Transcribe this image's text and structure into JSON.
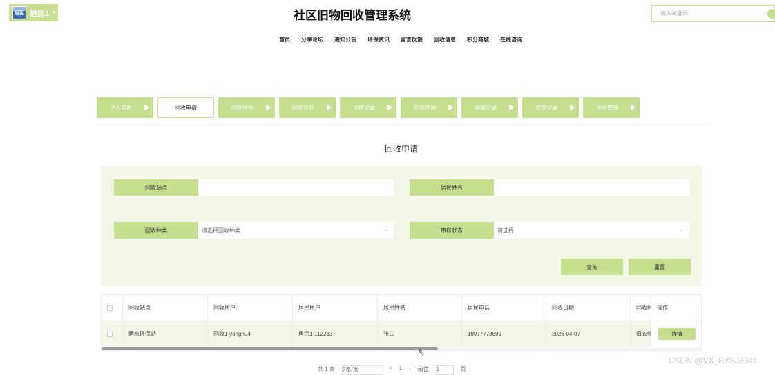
{
  "header": {
    "user_name": "居民1",
    "avatar_text": "居民",
    "site_title": "社区旧物回收管理系统",
    "search_placeholder": "输入关键词"
  },
  "nav": [
    "首页",
    "分享论坛",
    "通知公告",
    "环保资讯",
    "留言反馈",
    "回收信息",
    "积分商城",
    "在线咨询"
  ],
  "tabs": [
    {
      "label": "个人首页",
      "active": false
    },
    {
      "label": "回收申请",
      "active": true
    },
    {
      "label": "回收评估",
      "active": false
    },
    {
      "label": "回收评价",
      "active": false
    },
    {
      "label": "兑换记录",
      "active": false
    },
    {
      "label": "在线咨询",
      "active": false
    },
    {
      "label": "收藏记录",
      "active": false
    },
    {
      "label": "点赞记录",
      "active": false
    },
    {
      "label": "评论管理",
      "active": false
    }
  ],
  "section_title": "回收申请",
  "filters": {
    "station_label": "回收站点",
    "station_value": "",
    "resident_name_label": "居民姓名",
    "resident_name_value": "",
    "category_label": "回收种类",
    "category_placeholder": "请选择回收种类",
    "status_label": "审核状态",
    "status_placeholder": "请选择",
    "query_button": "查询",
    "reset_button": "重置"
  },
  "table": {
    "columns": [
      "回收站点",
      "回收用户",
      "居民用户",
      "居民姓名",
      "居民电话",
      "回收日期",
      "回收种"
    ],
    "operation_label": "操作",
    "rows": [
      {
        "cells": [
          "碧水环保站",
          "回收1-yonghu4",
          "居民1-112233",
          "张三",
          "18977778899",
          "2026-04-07",
          "旧衣物"
        ],
        "action": "详情"
      }
    ],
    "scroll_fraction": 0.56
  },
  "pager": {
    "total": "共 1 条",
    "page_size": "7条/页",
    "current_page": "1",
    "goto_label": "前往",
    "goto_value": "1",
    "page_unit": "页"
  },
  "watermark": "CSDN @VX_BYSJ8341"
}
